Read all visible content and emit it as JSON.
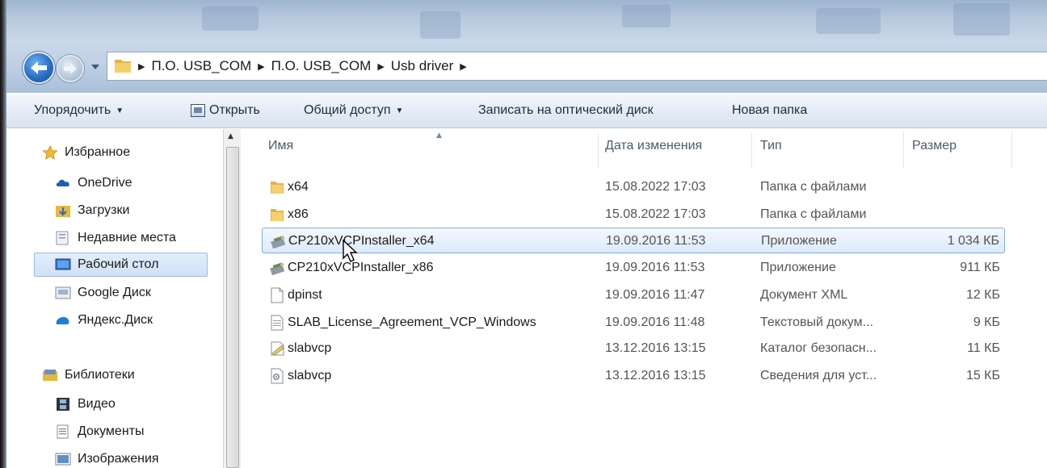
{
  "address": {
    "crumbs": [
      "П.О. USB_COM",
      "П.О. USB_COM",
      "Usb driver"
    ]
  },
  "toolbar": {
    "organize": "Упорядочить",
    "open": "Открыть",
    "share": "Общий доступ",
    "burn": "Записать на оптический диск",
    "new_folder": "Новая папка"
  },
  "nav": {
    "favorites_label": "Избранное",
    "favorites": [
      "OneDrive",
      "Загрузки",
      "Недавние места",
      "Рабочий стол",
      "Google Диск",
      "Яндекс.Диск"
    ],
    "libraries_label": "Библиотеки",
    "libraries": [
      "Видео",
      "Документы",
      "Изображения"
    ]
  },
  "columns": {
    "name": "Имя",
    "date": "Дата изменения",
    "type": "Тип",
    "size": "Размер"
  },
  "files": [
    {
      "name": "x64",
      "date": "15.08.2022 17:03",
      "type": "Папка с файлами",
      "size": "",
      "icon": "folder-icon"
    },
    {
      "name": "x86",
      "date": "15.08.2022 17:03",
      "type": "Папка с файлами",
      "size": "",
      "icon": "folder-icon"
    },
    {
      "name": "CP210xVCPInstaller_x64",
      "date": "19.09.2016 11:53",
      "type": "Приложение",
      "size": "1 034 КБ",
      "icon": "installer-icon"
    },
    {
      "name": "CP210xVCPInstaller_x86",
      "date": "19.09.2016 11:53",
      "type": "Приложение",
      "size": "911 КБ",
      "icon": "installer-icon"
    },
    {
      "name": "dpinst",
      "date": "19.09.2016 11:47",
      "type": "Документ XML",
      "size": "12 КБ",
      "icon": "document-icon"
    },
    {
      "name": "SLAB_License_Agreement_VCP_Windows",
      "date": "19.09.2016 11:48",
      "type": "Текстовый докум...",
      "size": "9 КБ",
      "icon": "text-document-icon"
    },
    {
      "name": "slabvcp",
      "date": "13.12.2016 13:15",
      "type": "Каталог безопасн...",
      "size": "11 КБ",
      "icon": "security-catalog-icon"
    },
    {
      "name": "slabvcp",
      "date": "13.12.2016 13:15",
      "type": "Сведения для уст...",
      "size": "15 КБ",
      "icon": "setup-info-icon"
    }
  ],
  "colors": {
    "selection_border": "#84acdd",
    "glass": "#b6c8dd",
    "toolbar": "#e5ecf5"
  }
}
